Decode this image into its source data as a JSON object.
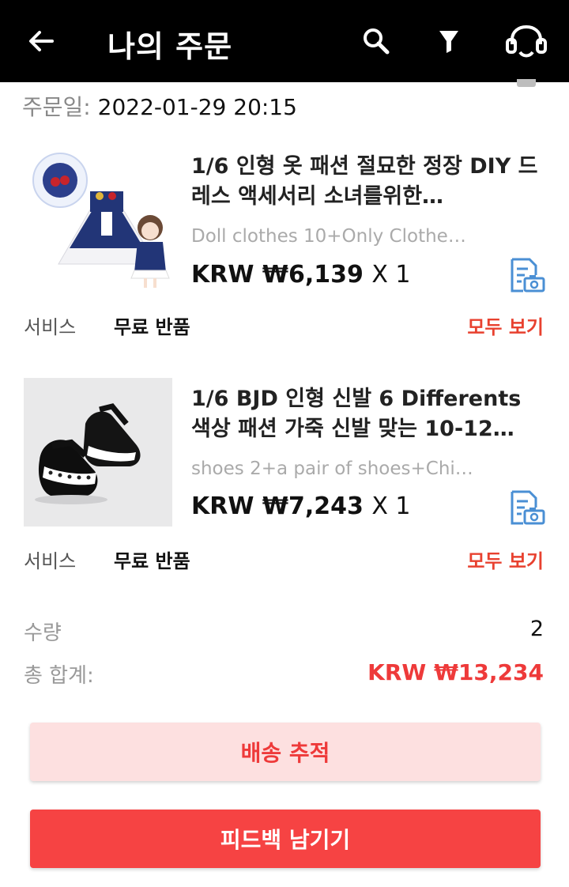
{
  "header": {
    "title": "나의 주문"
  },
  "order": {
    "date_label": "주문일:",
    "date_value": "2022-01-29 20:15"
  },
  "items": [
    {
      "title": "1/6 인형 옷 패션 절묘한 정장 DIY 드레스 액세서리 소녀를위한…",
      "sku": "Doll clothes 10+Only Clothe…",
      "price": "KRW ₩6,139",
      "qty": "X 1",
      "service_label": "서비스",
      "service_value": "무료 반품",
      "see_all": "모두 보기"
    },
    {
      "title": "1/6 BJD 인형 신발 6 Differents 색상 패션 가죽 신발 맞는 10-12…",
      "sku": "shoes 2+a pair of shoes+Chi…",
      "price": "KRW ₩7,243",
      "qty": "X 1",
      "service_label": "서비스",
      "service_value": "무료 반품",
      "see_all": "모두 보기"
    }
  ],
  "summary": {
    "quantity_label": "수량",
    "quantity_value": "2",
    "total_label": "총 합계:",
    "total_value": "KRW ₩13,234"
  },
  "buttons": {
    "track": "배송 추적",
    "feedback": "피드백 남기기"
  },
  "icons": {
    "back": "arrow-left-icon",
    "search": "search-icon",
    "filter": "filter-icon",
    "support": "headset-icon",
    "photo_review": "photo-review-icon"
  },
  "colors": {
    "header_bg": "#000000",
    "accent_red": "#ee3a3a",
    "track_bg": "#fde0e0",
    "feedback_bg": "#f64343",
    "icon_blue": "#4a8fd4"
  }
}
